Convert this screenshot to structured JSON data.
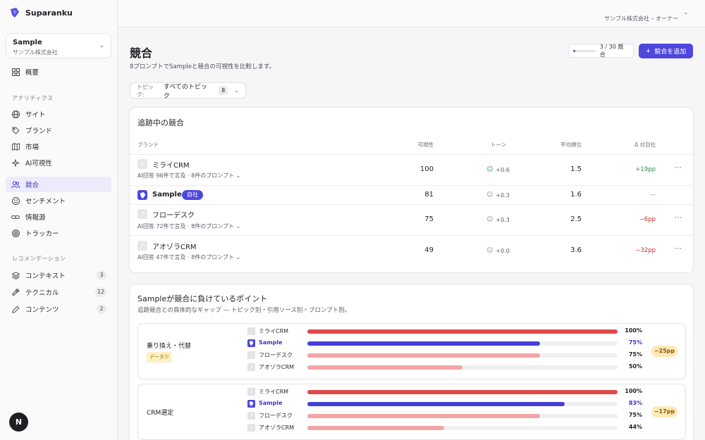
{
  "app": {
    "name": "Suparanku"
  },
  "workspace": {
    "name": "Sample",
    "org": "サンプル株式会社"
  },
  "user": {
    "role_line": "サンプル株式会社 – オーナー"
  },
  "nav": {
    "overview": "概要",
    "analytics_label": "アナリティクス",
    "analytics": [
      {
        "label": "サイト",
        "icon": "globe-icon"
      },
      {
        "label": "ブランド",
        "icon": "tag-icon"
      },
      {
        "label": "市場",
        "icon": "map-icon"
      },
      {
        "label": "AI可視性",
        "icon": "sparkle-icon"
      }
    ],
    "main": [
      {
        "label": "競合",
        "icon": "users-icon",
        "active": true
      },
      {
        "label": "センチメント",
        "icon": "smile-icon"
      },
      {
        "label": "情報源",
        "icon": "link-icon"
      },
      {
        "label": "トラッカー",
        "icon": "target-icon"
      }
    ],
    "reco_label": "レコメンデーション",
    "reco": [
      {
        "label": "コンテキスト",
        "icon": "layers-icon",
        "count": "3"
      },
      {
        "label": "テクニカル",
        "icon": "wrench-icon",
        "count": "12"
      },
      {
        "label": "コンテンツ",
        "icon": "pen-icon",
        "count": "2"
      }
    ]
  },
  "page": {
    "title": "競合",
    "subtitle": "8プロンプトでSampleと競合の可視性を比較します。",
    "quota_text": "3 / 30 競合",
    "quota_fraction": 0.1,
    "add_button": "競合を追加"
  },
  "topic_filter": {
    "key": "トピック:",
    "value": "すべてのトピック",
    "count": "8"
  },
  "tracked": {
    "title": "追跡中の競合",
    "headers": {
      "brand": "ブランド",
      "visibility": "可視性",
      "tone": "トーン",
      "rank": "平均順位",
      "delta": "Δ 対自社"
    },
    "rows": [
      {
        "icon": "ミ",
        "name": "ミライCRM",
        "own": false,
        "sub": "AI回答 96件で言及 · 8件のプロンプト",
        "visibility": "100",
        "tone": "+0.6",
        "tone_kind": "pos",
        "rank": "1.5",
        "delta": "+19pp",
        "delta_kind": "up"
      },
      {
        "icon": "S",
        "name": "Sample",
        "own": true,
        "badge": "自社",
        "sub": "",
        "visibility": "81",
        "tone": "+0.3",
        "tone_kind": "neu",
        "rank": "1.6",
        "delta": "—",
        "delta_kind": "none"
      },
      {
        "icon": "フ",
        "name": "フローデスク",
        "own": false,
        "sub": "AI回答 72件で言及 · 8件のプロンプト",
        "visibility": "75",
        "tone": "+0.3",
        "tone_kind": "neu",
        "rank": "2.5",
        "delta": "−6pp",
        "delta_kind": "down"
      },
      {
        "icon": "ア",
        "name": "アオゾラCRM",
        "own": false,
        "sub": "AI回答 47件で言及 · 8件のプロンプト",
        "visibility": "49",
        "tone": "+0.0",
        "tone_kind": "neu",
        "rank": "3.6",
        "delta": "−32pp",
        "delta_kind": "down"
      }
    ]
  },
  "losing": {
    "title": "Sampleが競合に負けているポイント",
    "subtitle": "追跡競合との具体的なギャップ — トピック別・引用ソース別・プロンプト別。",
    "groups": [
      {
        "name": "乗り換え・代替",
        "flag": "データ少",
        "delta": "−25pp",
        "bars": [
          {
            "icon": "ミ",
            "label": "ミライCRM",
            "pct": "100%",
            "value": 100,
            "color": "#e04848",
            "own": false
          },
          {
            "icon": "S",
            "label": "Sample",
            "pct": "75%",
            "value": 75,
            "color": "#4440d6",
            "own": true
          },
          {
            "icon": "フ",
            "label": "フローデスク",
            "pct": "75%",
            "value": 75,
            "color": "#f2a5a5",
            "own": false
          },
          {
            "icon": "ア",
            "label": "アオゾラCRM",
            "pct": "50%",
            "value": 50,
            "color": "#f2a5a5",
            "own": false
          }
        ]
      },
      {
        "name": "CRM選定",
        "flag": "",
        "delta": "−17pp",
        "bars": [
          {
            "icon": "ミ",
            "label": "ミライCRM",
            "pct": "100%",
            "value": 100,
            "color": "#e04848",
            "own": false
          },
          {
            "icon": "S",
            "label": "Sample",
            "pct": "83%",
            "value": 83,
            "color": "#4440d6",
            "own": true
          },
          {
            "icon": "フ",
            "label": "フローデスク",
            "pct": "75%",
            "value": 75,
            "color": "#f2a5a5",
            "own": false
          },
          {
            "icon": "ア",
            "label": "アオゾラCRM",
            "pct": "44%",
            "value": 44,
            "color": "#f2a5a5",
            "own": false
          }
        ]
      }
    ]
  },
  "floating": {
    "label": "N"
  }
}
